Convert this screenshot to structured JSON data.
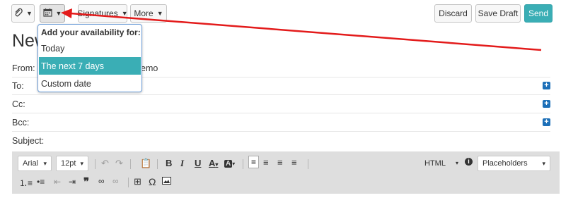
{
  "toolbar": {
    "attach_icon": "paperclip-icon",
    "calendar_icon": "calendar-icon",
    "signatures_label": "Signatures",
    "more_label": "More",
    "discard_label": "Discard",
    "save_draft_label": "Save Draft",
    "send_label": "Send",
    "send_color": "#3aaeb5"
  },
  "page": {
    "title": "New"
  },
  "fields": {
    "from_label": "From:",
    "from_value_partial": "emo",
    "to_label": "To:",
    "cc_label": "Cc:",
    "bcc_label": "Bcc:",
    "subject_label": "Subject:"
  },
  "dropdown": {
    "header": "Add your availability for:",
    "items": [
      {
        "label": "Today"
      },
      {
        "label": "The next 7 days",
        "selected": true
      },
      {
        "label": "Custom date"
      }
    ]
  },
  "editor": {
    "font": "Arial",
    "size": "12pt",
    "format": "HTML",
    "placeholders": "Placeholders"
  },
  "annotation": {
    "arrow_color": "#e31b1b"
  }
}
